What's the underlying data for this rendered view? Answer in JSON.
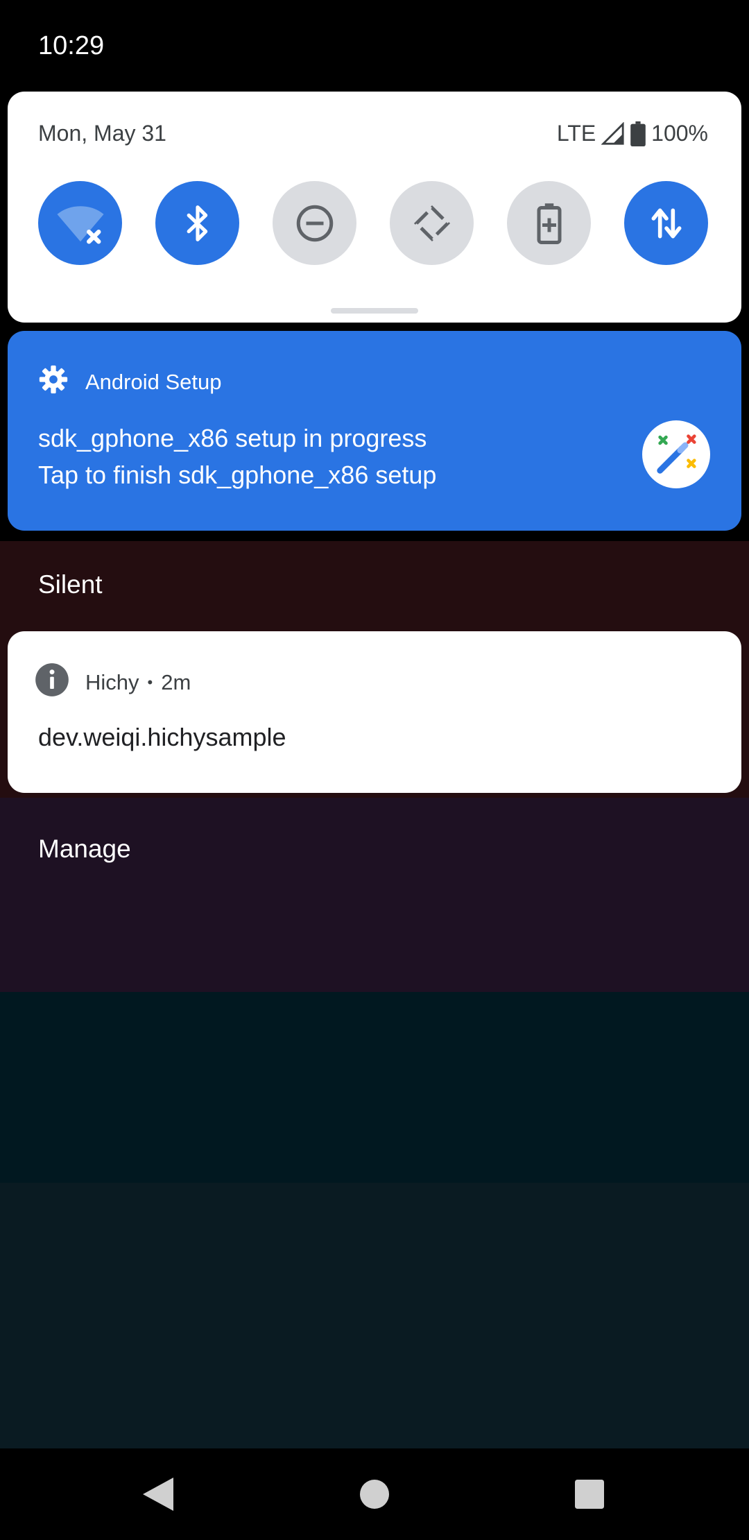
{
  "status_bar": {
    "time": "10:29"
  },
  "quick_settings": {
    "date": "Mon, May 31",
    "network": "LTE",
    "battery": "100%",
    "tiles": [
      {
        "name": "wifi",
        "icon": "wifi-off-icon",
        "active": true
      },
      {
        "name": "bluetooth",
        "icon": "bluetooth-icon",
        "active": true
      },
      {
        "name": "do-not-disturb",
        "icon": "do-not-disturb-icon",
        "active": false
      },
      {
        "name": "auto-rotate",
        "icon": "auto-rotate-icon",
        "active": false
      },
      {
        "name": "battery-saver",
        "icon": "battery-saver-icon",
        "active": false
      },
      {
        "name": "mobile-data",
        "icon": "mobile-data-icon",
        "active": true
      }
    ]
  },
  "setup_notification": {
    "app_name": "Android Setup",
    "title": "sdk_gphone_x86 setup in progress",
    "text": "Tap to finish sdk_gphone_x86 setup",
    "icon": "gear-icon",
    "large_icon": "magic-wand-icon"
  },
  "silent_section": {
    "label": "Silent"
  },
  "hichy_notification": {
    "app_name": "Hichy",
    "separator": "•",
    "time": "2m",
    "text": "dev.weiqi.hichysample",
    "icon": "info-icon"
  },
  "manage": {
    "label": "Manage"
  },
  "nav_bar": {
    "buttons": [
      "back",
      "home",
      "recents"
    ]
  },
  "colors": {
    "accent": "#2a74e3",
    "tile_off": "#dadce0",
    "panel": "#ffffff"
  }
}
